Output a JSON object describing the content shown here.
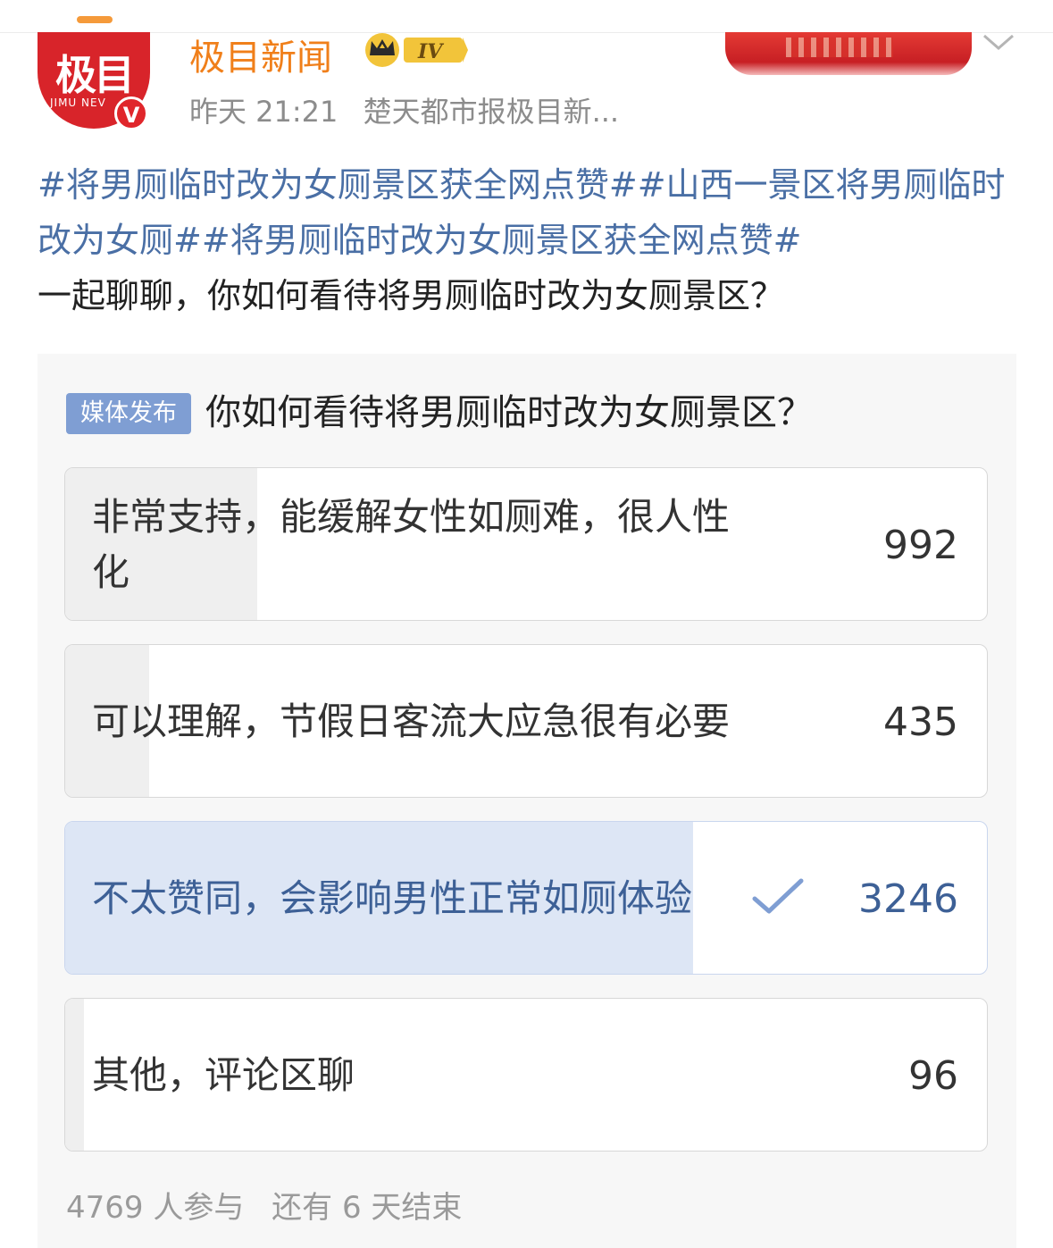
{
  "header": {
    "account_name": "极目新闻",
    "avatar_logo_text": "极目",
    "avatar_sub_text": "JIMU NEV",
    "verified_mark": "V",
    "level_badge": "IV",
    "time": "昨天 21:21",
    "source": "楚天都市报极目新..."
  },
  "post": {
    "tag1": "#将男厕临时改为女厕景区获全网点赞#",
    "tag2": "#山西一景区将男厕临时改为女厕#",
    "tag3": "#将男厕临时改为女厕景区获全网点赞#",
    "text": "一起聊聊，你如何看待将男厕临时改为女厕景区？"
  },
  "poll": {
    "badge": "媒体发布",
    "title": "你如何看待将男厕临时改为女厕景区？",
    "options": [
      {
        "label": "非常支持，能缓解女性如厕难，很人性化",
        "count": "992",
        "share": 0.208,
        "chosen": false
      },
      {
        "label": "可以理解，节假日客流大应急很有必要",
        "count": "435",
        "share": 0.091,
        "chosen": false
      },
      {
        "label": "不太赞同，会影响男性正常如厕体验",
        "count": "3246",
        "share": 0.681,
        "chosen": true
      },
      {
        "label": "其他，评论区聊",
        "count": "96",
        "share": 0.02,
        "chosen": false
      }
    ],
    "participants": "4769 人参与",
    "remaining": "还有 6 天结束"
  },
  "icons": {
    "check": "check-icon",
    "chevron": "chevron-down-icon",
    "crown": "crown-icon"
  },
  "colors": {
    "brand_orange": "#f07f1a",
    "tag_blue": "#4a6fa5",
    "chosen_fill": "#dde6f5",
    "chosen_text": "#3d6096",
    "media_badge": "#7f9ed3"
  }
}
